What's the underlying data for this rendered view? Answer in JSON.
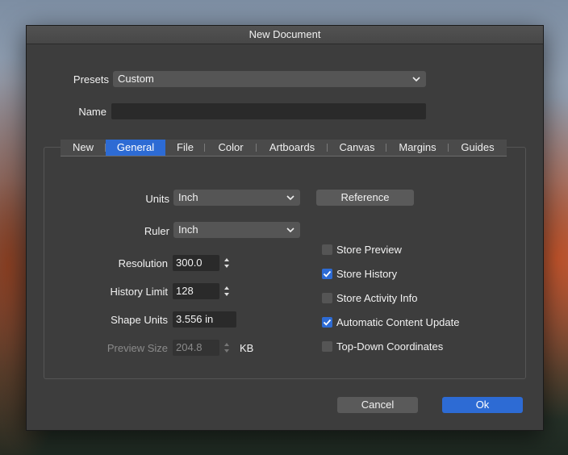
{
  "dialog": {
    "title": "New Document"
  },
  "presets": {
    "label": "Presets",
    "value": "Custom"
  },
  "name": {
    "label": "Name",
    "value": ""
  },
  "tabs": [
    {
      "label": "New"
    },
    {
      "label": "General"
    },
    {
      "label": "File"
    },
    {
      "label": "Color"
    },
    {
      "label": "Artboards"
    },
    {
      "label": "Canvas"
    },
    {
      "label": "Margins"
    },
    {
      "label": "Guides"
    }
  ],
  "active_tab": "General",
  "general": {
    "units": {
      "label": "Units",
      "value": "Inch"
    },
    "reference_button": "Reference",
    "ruler": {
      "label": "Ruler",
      "value": "Inch"
    },
    "resolution": {
      "label": "Resolution",
      "value": "300.0"
    },
    "history_limit": {
      "label": "History Limit",
      "value": "128"
    },
    "shape_units": {
      "label": "Shape Units",
      "value": "3.556 in"
    },
    "preview_size": {
      "label": "Preview Size",
      "value": "204.8",
      "unit": "KB"
    },
    "checkboxes": [
      {
        "label": "Store Preview",
        "checked": false
      },
      {
        "label": "Store History",
        "checked": true
      },
      {
        "label": "Store Activity Info",
        "checked": false
      },
      {
        "label": "Automatic Content Update",
        "checked": true
      },
      {
        "label": "Top-Down Coordinates",
        "checked": false
      }
    ]
  },
  "footer": {
    "cancel": "Cancel",
    "ok": "Ok"
  },
  "colors": {
    "accent": "#2d6bd4",
    "dialog_bg": "#3d3d3d"
  }
}
